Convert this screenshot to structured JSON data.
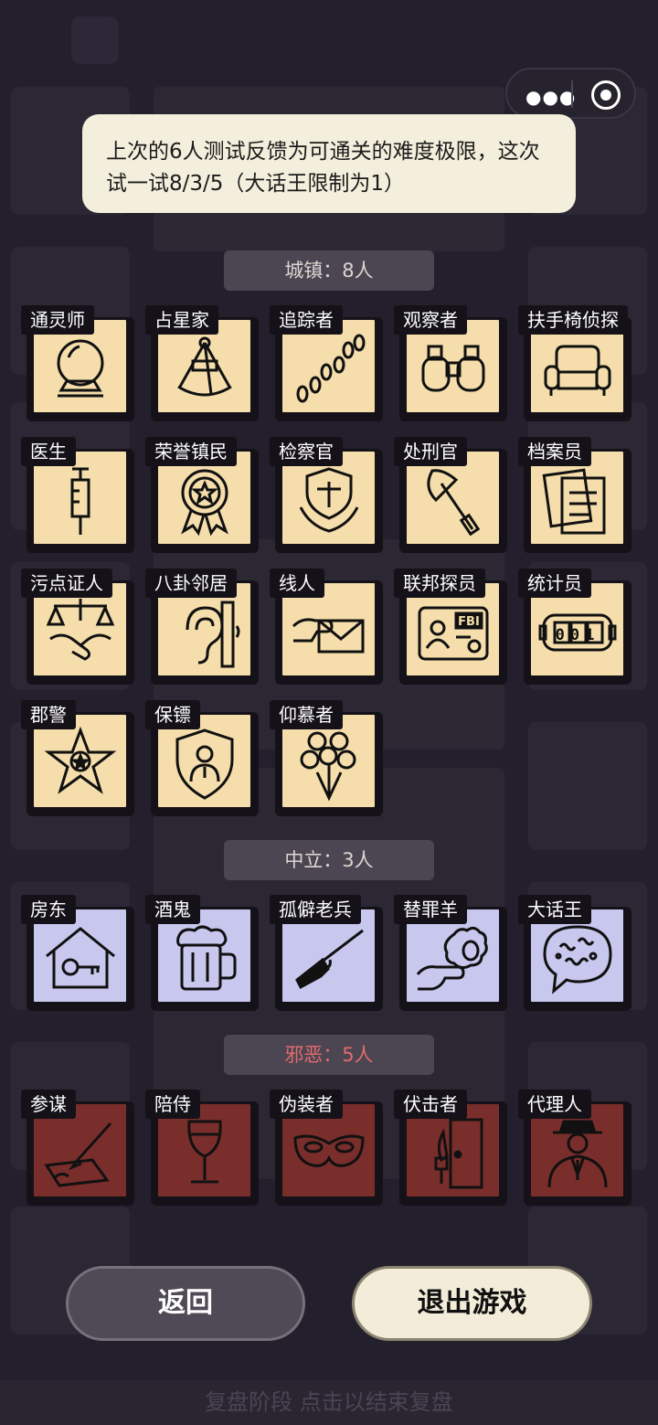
{
  "topbar": {
    "menu_icon": "more-dots-icon",
    "target_icon": "target-ring-icon"
  },
  "notice": {
    "text": "上次的6人测试反馈为可通关的难度极限，这次试一试8/3/5（大话王限制为1）"
  },
  "sections": {
    "town": {
      "label": "城镇：8人"
    },
    "neutral": {
      "label": "中立：3人"
    },
    "evil": {
      "label": "邪恶：5人"
    }
  },
  "roles": {
    "town": [
      {
        "name": "通灵师",
        "icon": "crystal-ball-icon"
      },
      {
        "name": "占星家",
        "icon": "sextant-icon"
      },
      {
        "name": "追踪者",
        "icon": "footprints-icon"
      },
      {
        "name": "观察者",
        "icon": "binoculars-icon"
      },
      {
        "name": "扶手椅侦探",
        "icon": "armchair-icon"
      },
      {
        "name": "医生",
        "icon": "syringe-icon"
      },
      {
        "name": "荣誉镇民",
        "icon": "medal-icon"
      },
      {
        "name": "检察官",
        "icon": "justice-badge-icon"
      },
      {
        "name": "处刑官",
        "icon": "axe-icon"
      },
      {
        "name": "档案员",
        "icon": "documents-icon"
      },
      {
        "name": "污点证人",
        "icon": "scales-handshake-icon"
      },
      {
        "name": "八卦邻居",
        "icon": "ear-icon"
      },
      {
        "name": "线人",
        "icon": "envelope-hand-icon"
      },
      {
        "name": "联邦探员",
        "icon": "fbi-badge-icon"
      },
      {
        "name": "统计员",
        "icon": "counter-icon"
      },
      {
        "name": "郡警",
        "icon": "sheriff-star-icon"
      },
      {
        "name": "保镖",
        "icon": "bodyguard-shield-icon"
      },
      {
        "name": "仰慕者",
        "icon": "bouquet-icon"
      }
    ],
    "neutral": [
      {
        "name": "房东",
        "icon": "house-key-icon"
      },
      {
        "name": "酒鬼",
        "icon": "beer-mug-icon"
      },
      {
        "name": "孤僻老兵",
        "icon": "rifle-icon"
      },
      {
        "name": "替罪羊",
        "icon": "sheep-pointing-icon"
      },
      {
        "name": "大话王",
        "icon": "speech-bubble-icon"
      }
    ],
    "evil": [
      {
        "name": "参谋",
        "icon": "pen-paper-icon"
      },
      {
        "name": "陪侍",
        "icon": "wine-glass-icon"
      },
      {
        "name": "伪装者",
        "icon": "mask-icon"
      },
      {
        "name": "伏击者",
        "icon": "knife-door-icon"
      },
      {
        "name": "代理人",
        "icon": "suited-man-icon"
      }
    ]
  },
  "buttons": {
    "back": "返回",
    "exit": "退出游戏"
  },
  "footer": {
    "text": "复盘阶段 点击以结束复盘"
  },
  "colors": {
    "background": "#231f2c",
    "town_card": "#f5deac",
    "neutral_card": "#c8c7ee",
    "evil_card": "#7a2e2b",
    "evil_label": "#e36b6b",
    "notice_bg": "#f4efdc"
  }
}
